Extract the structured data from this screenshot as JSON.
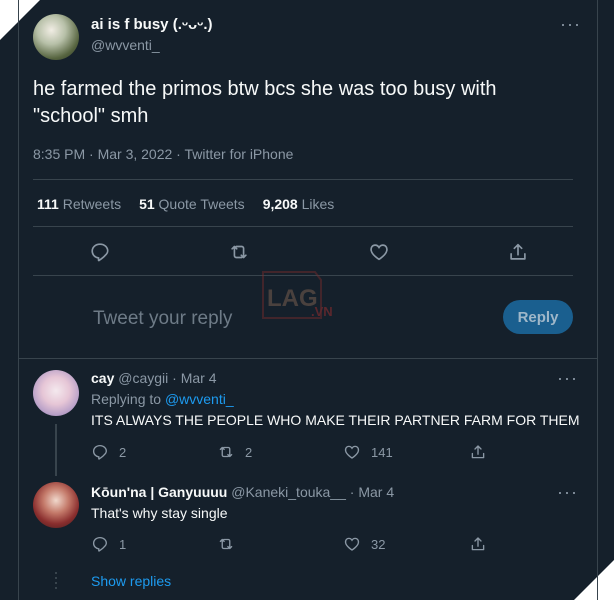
{
  "main_tweet": {
    "display_name": "ai is f busy (.ᵕᴗᵕ.)",
    "handle": "@wvventi_",
    "text": "he farmed the primos btw bcs she was too busy with \"school\" smh",
    "meta": "8:35 PM · Mar 3, 2022 · Twitter for iPhone",
    "stats": {
      "retweets_count": "111",
      "retweets_label": "Retweets",
      "quotes_count": "51",
      "quotes_label": "Quote Tweets",
      "likes_count": "9,208",
      "likes_label": "Likes"
    }
  },
  "reply_box": {
    "placeholder": "Tweet your reply",
    "button_label": "Reply"
  },
  "watermark": {
    "part1": "LAG",
    "part2": ".VN"
  },
  "replies": [
    {
      "display_name": "cay",
      "handle": "@caygii",
      "sep": "·",
      "date": "Mar 4",
      "replying_label": "Replying to",
      "replying_to": "@wvventi_",
      "text": "ITS ALWAYS THE PEOPLE WHO MAKE THEIR PARTNER FARM FOR THEM",
      "reply_count": "2",
      "retweet_count": "2",
      "like_count": "141"
    },
    {
      "display_name": "Kōun'na | Ganyuuuu",
      "handle": "@Kaneki_touka__",
      "sep": "·",
      "date": "Mar 4",
      "text": "That's why stay single",
      "reply_count": "1",
      "retweet_count": "",
      "like_count": "32"
    }
  ],
  "show_replies": "Show replies",
  "more_glyph": "···",
  "colors": {
    "background": "#15202b",
    "text": "#f7f9f9",
    "muted": "#8b98a5",
    "accent": "#1d9bf0",
    "border": "#38444d"
  }
}
